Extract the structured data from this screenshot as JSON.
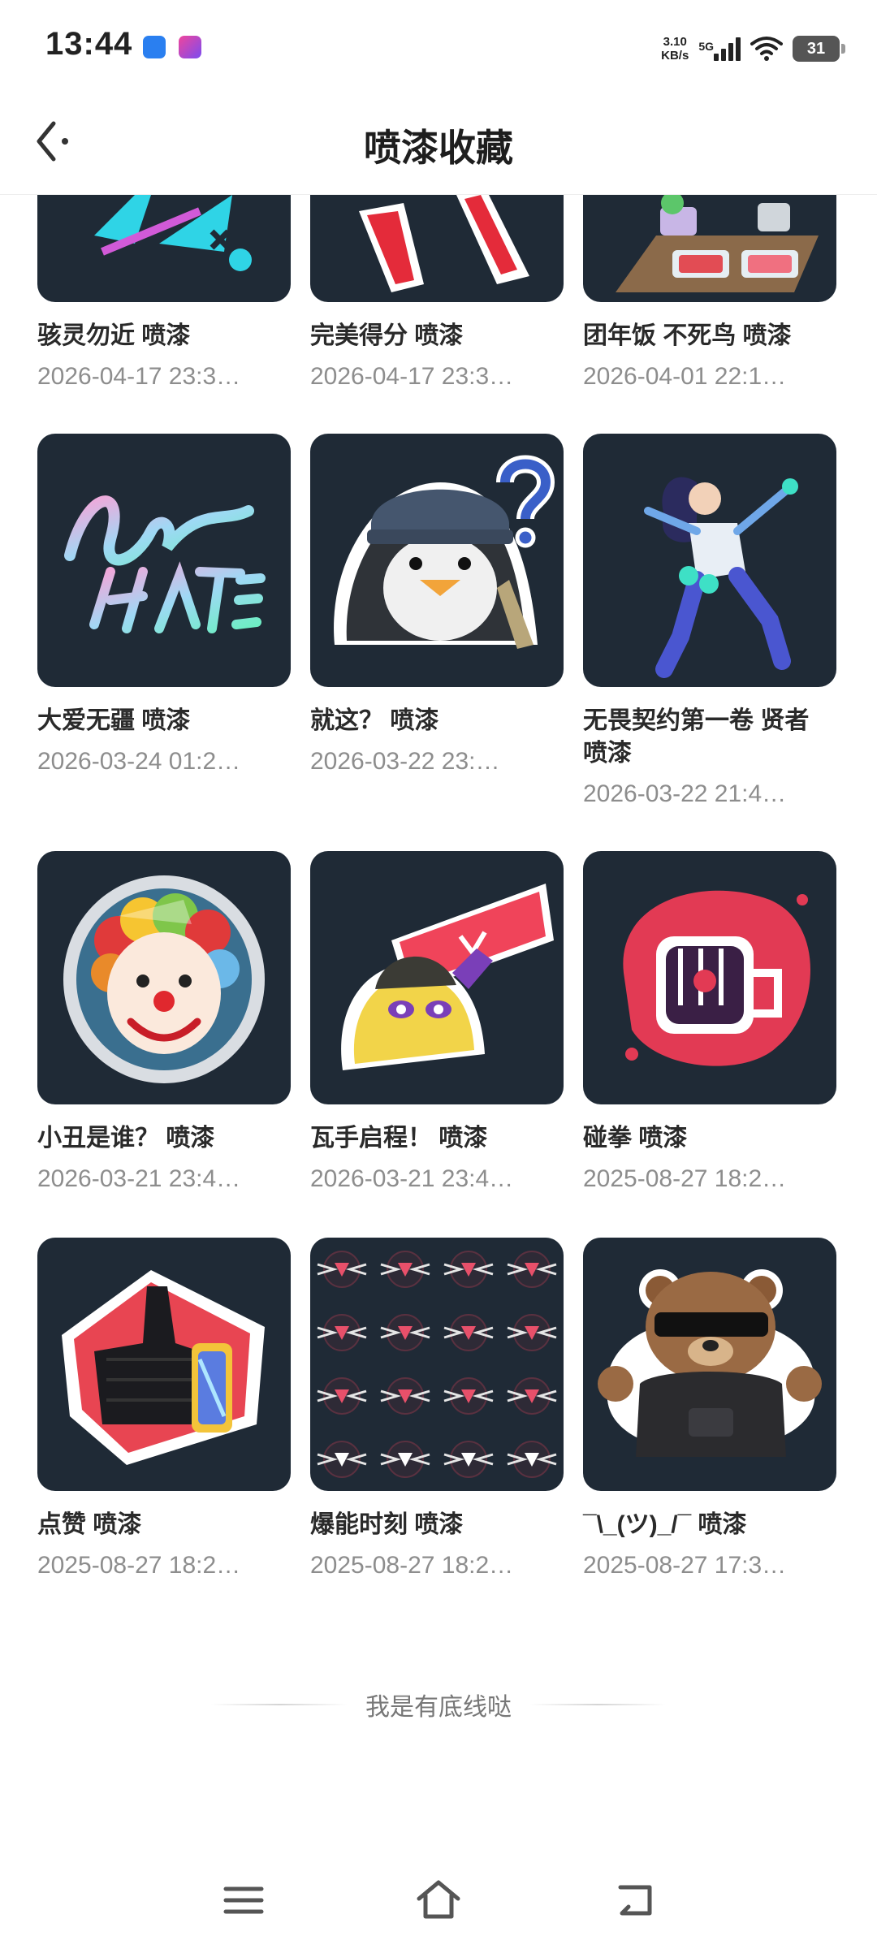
{
  "status_bar": {
    "time": "13:44",
    "net_speed_value": "3.10",
    "net_speed_unit": "KB/s",
    "network_type": "5G",
    "battery": "31"
  },
  "header": {
    "title": "喷漆收藏",
    "back_icon": "back-chevron-icon"
  },
  "items": [
    {
      "title": "骇灵勿近 喷漆",
      "date": "2026-04-17 23:3…",
      "icon": "graffiti-x-icon"
    },
    {
      "title": "完美得分 喷漆",
      "date": "2026-04-17 23:3…",
      "icon": "red-checkmark-icon"
    },
    {
      "title": "团年饭 不死鸟 喷漆",
      "date": "2026-04-01 22:1…",
      "icon": "dinner-table-icon"
    },
    {
      "title": "大爱无疆 喷漆",
      "date": "2026-03-24 01:2…",
      "icon": "love-over-hate-lettering-icon"
    },
    {
      "title": "就这？ 喷漆",
      "date": "2026-03-22 23:…",
      "icon": "question-penguin-icon"
    },
    {
      "title": "无畏契约第一卷 贤者 喷漆",
      "date": "2026-03-22 21:4…",
      "icon": "sage-agent-icon"
    },
    {
      "title": "小丑是谁？ 喷漆",
      "date": "2026-03-21 23:4…",
      "icon": "clown-mirror-icon"
    },
    {
      "title": "瓦手启程！ 喷漆",
      "date": "2026-03-21 23:4…",
      "icon": "creature-sign-icon"
    },
    {
      "title": "碰拳 喷漆",
      "date": "2025-08-27 18:2…",
      "icon": "fist-bump-icon"
    },
    {
      "title": "点赞 喷漆",
      "date": "2025-08-27 18:2…",
      "icon": "thumbs-up-icon"
    },
    {
      "title": "爆能时刻 喷漆",
      "date": "2025-08-27 18:2…",
      "icon": "pattern-grid-icon"
    },
    {
      "title": "¯\\_(ツ)_/¯ 喷漆",
      "date": "2025-08-27 17:3…",
      "icon": "shrug-bear-icon"
    }
  ],
  "footer_note": "我是有底线哒",
  "nav_bar": {
    "menu_icon": "menu-icon",
    "home_icon": "home-icon",
    "back_icon": "back-icon"
  },
  "colors": {
    "thumb_bg": "#1f2a36",
    "title_text": "#2a2a2a",
    "date_text": "#8d8d8d"
  }
}
